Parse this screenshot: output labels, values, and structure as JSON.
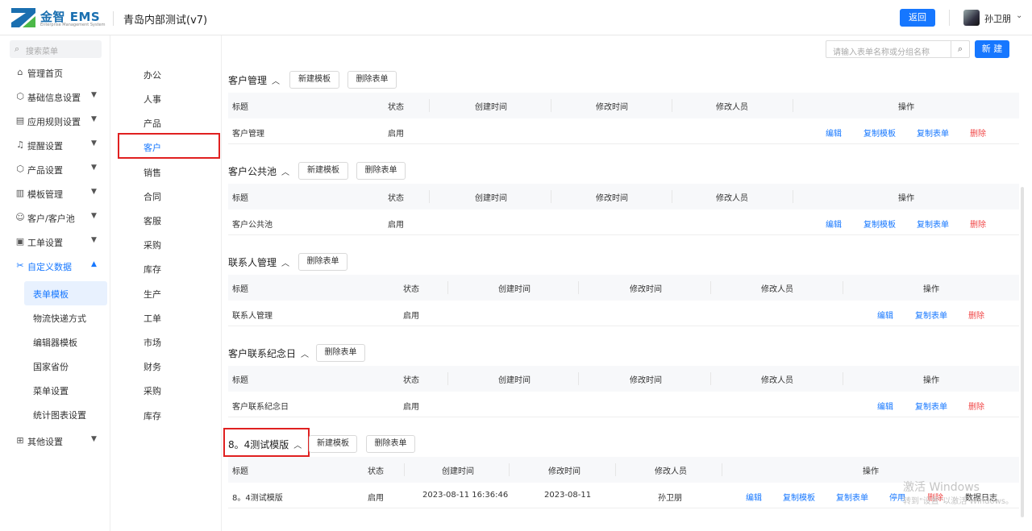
{
  "header": {
    "logo_text": "金智 EMS",
    "logo_sub": "Enterprise Management System",
    "app_title": "青岛内部测试(v7)",
    "back_label": "返回",
    "user_name": "孙卫朋"
  },
  "sidebar": {
    "search_placeholder": "搜索菜单",
    "items": [
      {
        "label": "管理首页",
        "icon": "home-icon"
      },
      {
        "label": "基础信息设置",
        "icon": "cube-icon"
      },
      {
        "label": "应用规则设置",
        "icon": "document-icon"
      },
      {
        "label": "提醒设置",
        "icon": "bell-icon"
      },
      {
        "label": "产品设置",
        "icon": "box-icon"
      },
      {
        "label": "模板管理",
        "icon": "template-icon"
      },
      {
        "label": "客户/客户池",
        "icon": "users-icon"
      },
      {
        "label": "工单设置",
        "icon": "ticket-icon"
      },
      {
        "label": "自定义数据",
        "icon": "custom-icon"
      }
    ],
    "sub_items": [
      "表单模板",
      "物流快递方式",
      "编辑器模板",
      "国家省份",
      "菜单设置",
      "统计图表设置"
    ],
    "other_settings": "其他设置"
  },
  "categories": [
    "办公",
    "人事",
    "产品",
    "客户",
    "销售",
    "合同",
    "客服",
    "采购",
    "库存",
    "生产",
    "工单",
    "市场",
    "财务",
    "采购",
    "库存"
  ],
  "toolbar": {
    "search_placeholder": "请输入表单名称或分组名称",
    "new_label": "新 建"
  },
  "buttons": {
    "new_template": "新建模板",
    "delete_form": "删除表单"
  },
  "columns": [
    "标题",
    "状态",
    "创建时间",
    "修改时间",
    "修改人员",
    "操作"
  ],
  "actions": {
    "edit": "编辑",
    "copy_template": "复制模板",
    "copy_form": "复制表单",
    "delete": "删除",
    "disable": "停用",
    "data_log": "数据日志"
  },
  "sections": [
    {
      "title": "客户管理",
      "row": {
        "title": "客户管理",
        "status": "启用"
      }
    },
    {
      "title": "客户公共池",
      "row": {
        "title": "客户公共池",
        "status": "启用"
      }
    },
    {
      "title": "联系人管理",
      "row": {
        "title": "联系人管理",
        "status": "启用"
      }
    },
    {
      "title": "客户联系纪念日",
      "row": {
        "title": "客户联系纪念日",
        "status": "启用"
      }
    },
    {
      "title": "8。4测试模版",
      "row": {
        "title": "8。4测试模版",
        "status": "启用",
        "created": "2023-08-11 16:36:46",
        "modified": "2023-08-11",
        "modifier": "孙卫朋"
      }
    }
  ],
  "watermark": {
    "line1": "激活 Windows",
    "line2": "转到\"设置\"以激活 Windows。"
  }
}
